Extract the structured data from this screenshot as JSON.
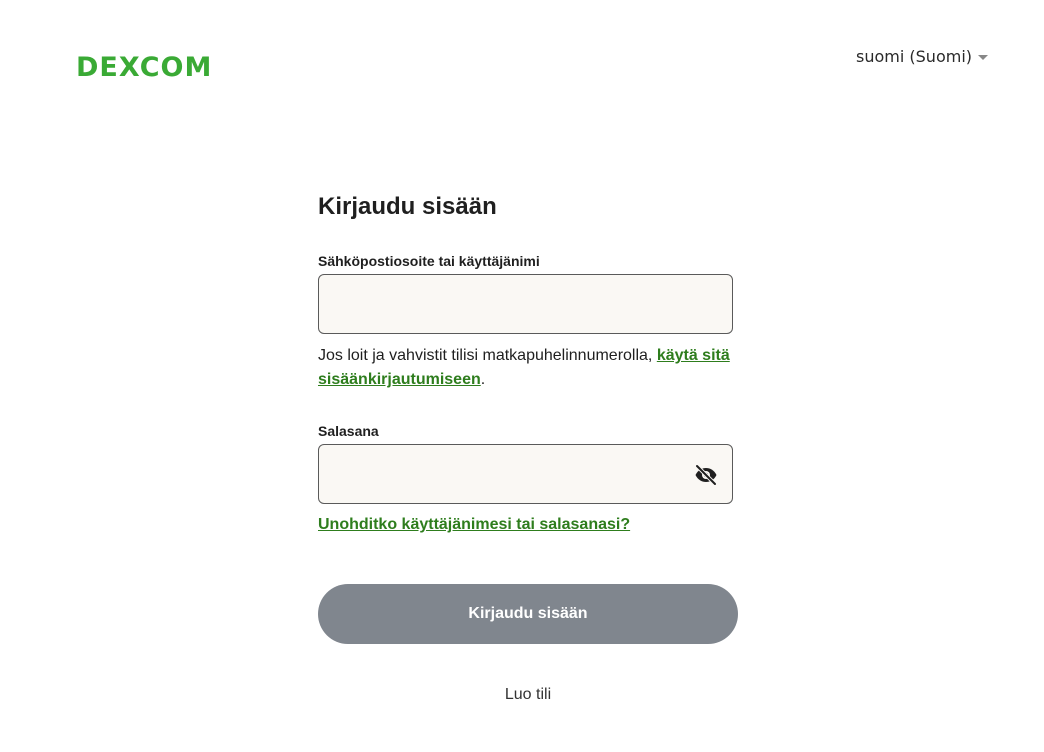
{
  "header": {
    "logo_text": "Dexcom",
    "language": "suomi (Suomi)"
  },
  "form": {
    "title": "Kirjaudu sisään",
    "email_label": "Sähköpostiosoite tai käyttäjänimi",
    "email_value": "",
    "hint_text": "Jos loit ja vahvistit tilisi matkapuhelinnumerolla, ",
    "hint_link": "käytä sitä sisäänkirjautumiseen",
    "hint_end": ".",
    "password_label": "Salasana",
    "password_value": "",
    "forgot_link": "Unohditko käyttäjänimesi tai salasanasi?",
    "submit_label": "Kirjaudu sisään",
    "create_account": "Luo tili"
  },
  "colors": {
    "brand_green": "#3aaa35",
    "link_green": "#2e7d1d",
    "button_gray": "#80868e",
    "field_bg": "#faf8f4"
  },
  "icons": {
    "password_toggle": "eye-off-icon",
    "language_caret": "caret-down-icon"
  }
}
